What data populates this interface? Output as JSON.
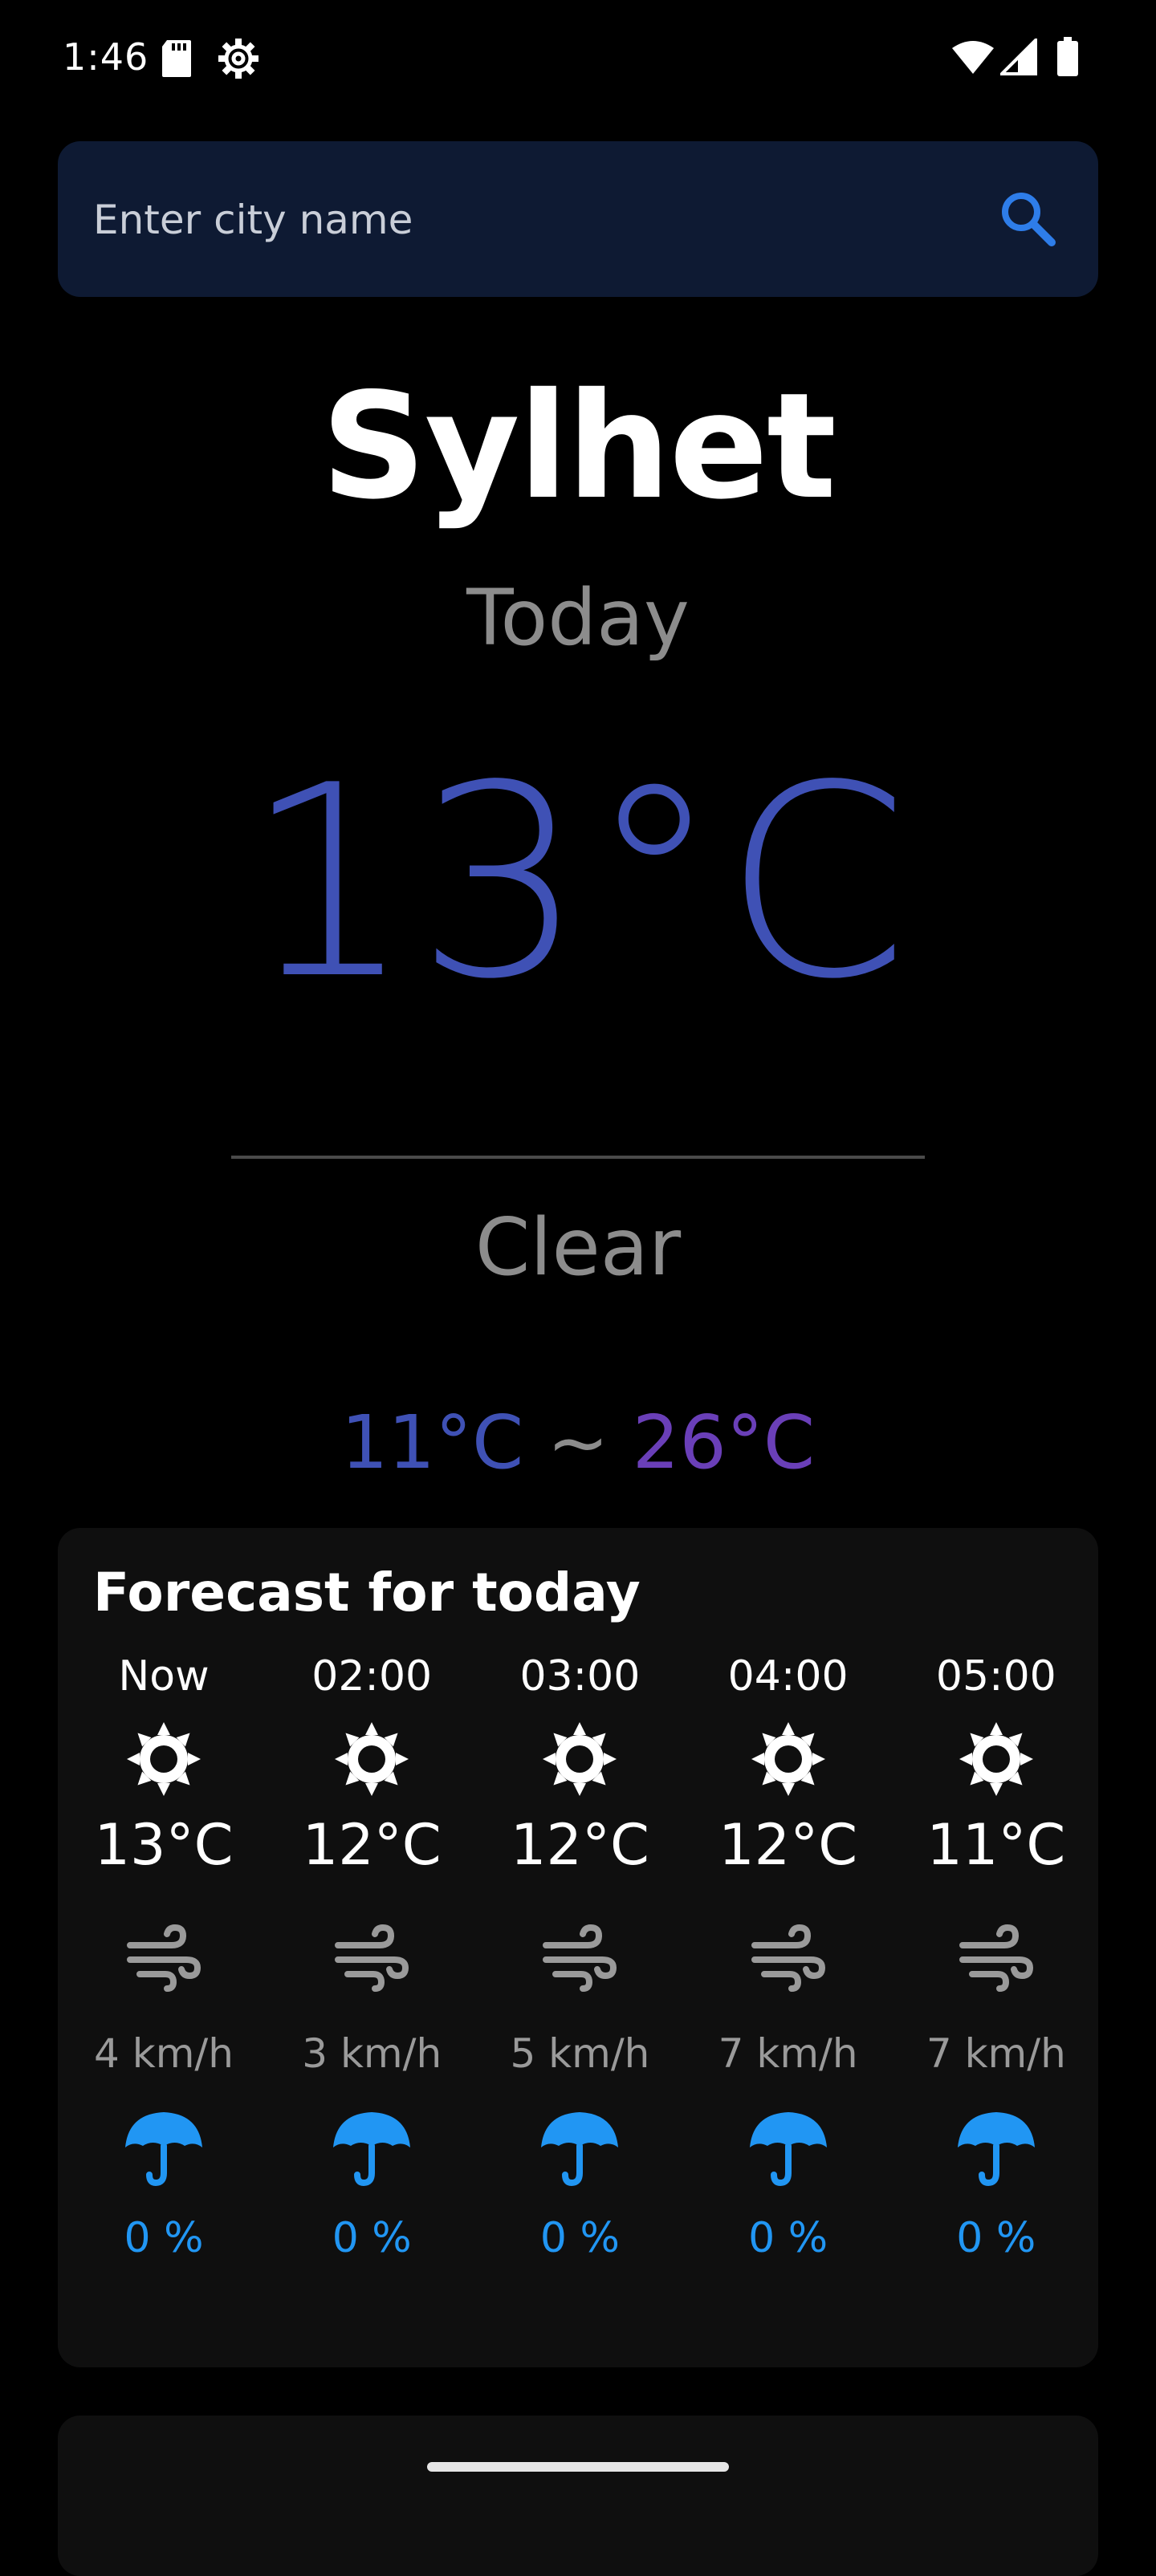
{
  "status_bar": {
    "time": "1:46",
    "icons": [
      "sd-card-icon",
      "settings-gear-icon",
      "wifi-icon",
      "cell-signal-icon",
      "battery-icon"
    ]
  },
  "search": {
    "placeholder": "Enter city name",
    "value": "",
    "icon": "search-icon"
  },
  "current": {
    "city": "Sylhet",
    "day": "Today",
    "temperature": "13°C",
    "condition": "Clear",
    "min_temp": "11°C",
    "separator": "~",
    "max_temp": "26°C"
  },
  "forecast": {
    "title": "Forecast for today",
    "hours": [
      {
        "time": "Now",
        "temp": "13°C",
        "wind": "4 km/h",
        "rain": "0 %",
        "icon": "sun-icon"
      },
      {
        "time": "02:00",
        "temp": "12°C",
        "wind": "3 km/h",
        "rain": "0 %",
        "icon": "sun-icon"
      },
      {
        "time": "03:00",
        "temp": "12°C",
        "wind": "5 km/h",
        "rain": "0 %",
        "icon": "sun-icon"
      },
      {
        "time": "04:00",
        "temp": "12°C",
        "wind": "7 km/h",
        "rain": "0 %",
        "icon": "sun-icon"
      },
      {
        "time": "05:00",
        "temp": "11°C",
        "wind": "7 km/h",
        "rain": "0 %",
        "icon": "sun-icon"
      }
    ]
  },
  "colors": {
    "background": "#000000",
    "search_bg": "#0e1a33",
    "accent_blue": "#3f51b5",
    "accent_purple": "#6a3fb8",
    "muted_text": "#8c8c8c",
    "rain_blue": "#2196f3",
    "card_bg": "#0f0f0f"
  }
}
